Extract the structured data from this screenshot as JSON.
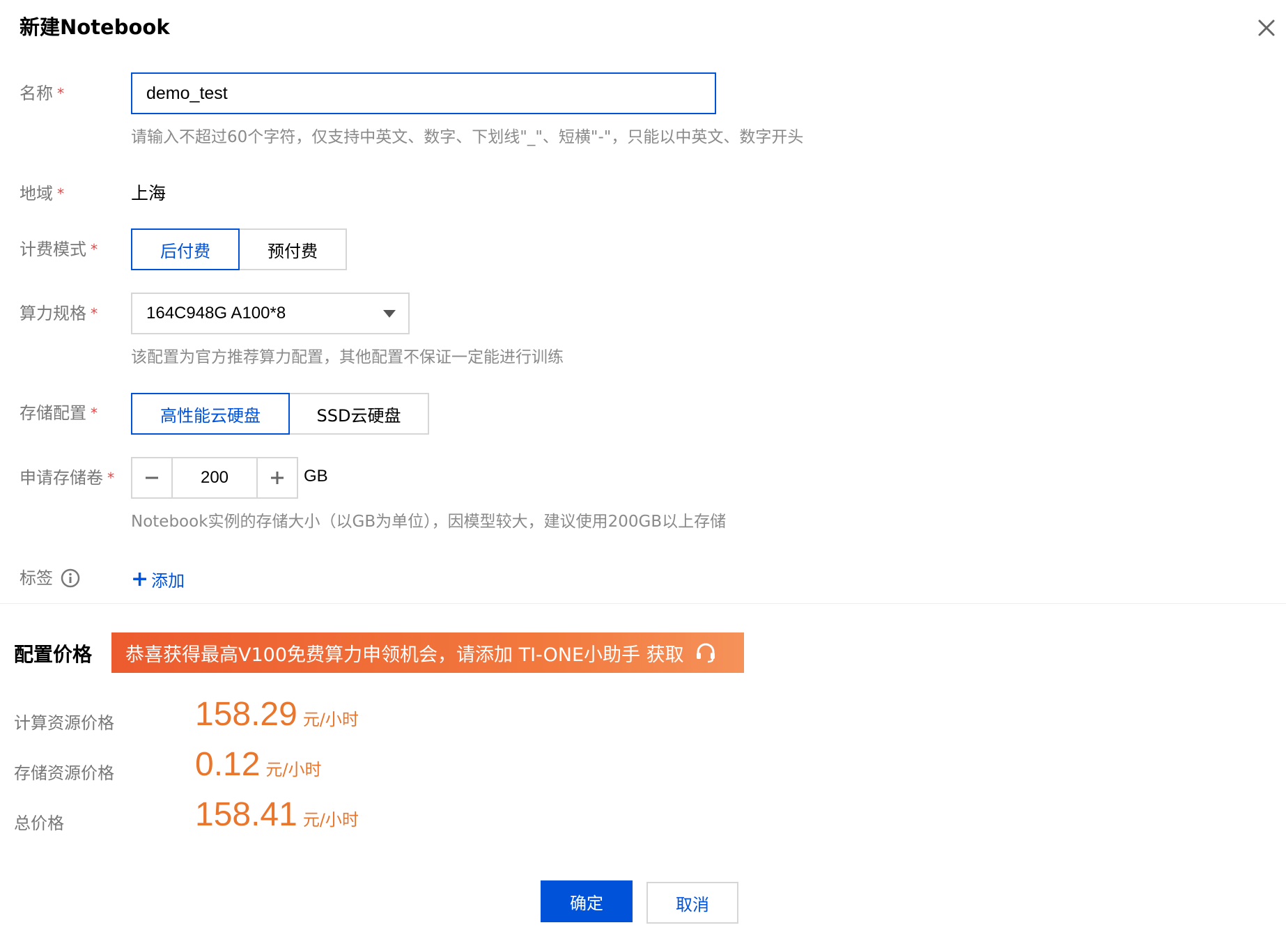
{
  "dialog": {
    "title": "新建Notebook"
  },
  "form": {
    "name": {
      "label": "名称",
      "required": "*",
      "value": "demo_test",
      "hint": "请输入不超过60个字符，仅支持中英文、数字、下划线\"_\"、短横\"-\"，只能以中英文、数字开头"
    },
    "region": {
      "label": "地域",
      "required": "*",
      "value": "上海"
    },
    "billing": {
      "label": "计费模式",
      "required": "*",
      "options": [
        "后付费",
        "预付费"
      ],
      "selected": "后付费"
    },
    "spec": {
      "label": "算力规格",
      "required": "*",
      "value": "164C948G A100*8",
      "hint": "该配置为官方推荐算力配置，其他配置不保证一定能进行训练"
    },
    "storage": {
      "label": "存储配置",
      "required": "*",
      "options": [
        "高性能云硬盘",
        "SSD云硬盘"
      ],
      "selected": "高性能云硬盘"
    },
    "volume": {
      "label": "申请存储卷",
      "required": "*",
      "value": "200",
      "unit": "GB",
      "hint": "Notebook实例的存储大小（以GB为单位），因模型较大，建议使用200GB以上存储"
    },
    "tags": {
      "label": "标签",
      "add_label": "添加"
    }
  },
  "pricing": {
    "title": "配置价格",
    "promo": "恭喜获得最高V100免费算力申领机会，请添加 TI-ONE小助手 获取",
    "rows": [
      {
        "label": "计算资源价格",
        "value": "158.29",
        "unit": "元/小时"
      },
      {
        "label": "存储资源价格",
        "value": "0.12",
        "unit": "元/小时"
      },
      {
        "label": "总价格",
        "value": "158.41",
        "unit": "元/小时"
      }
    ]
  },
  "footer": {
    "confirm": "确定",
    "cancel": "取消"
  },
  "colors": {
    "primary": "#0052d9",
    "price": "#e8762d",
    "promo": "#ec5b2e",
    "required": "#e54545"
  }
}
